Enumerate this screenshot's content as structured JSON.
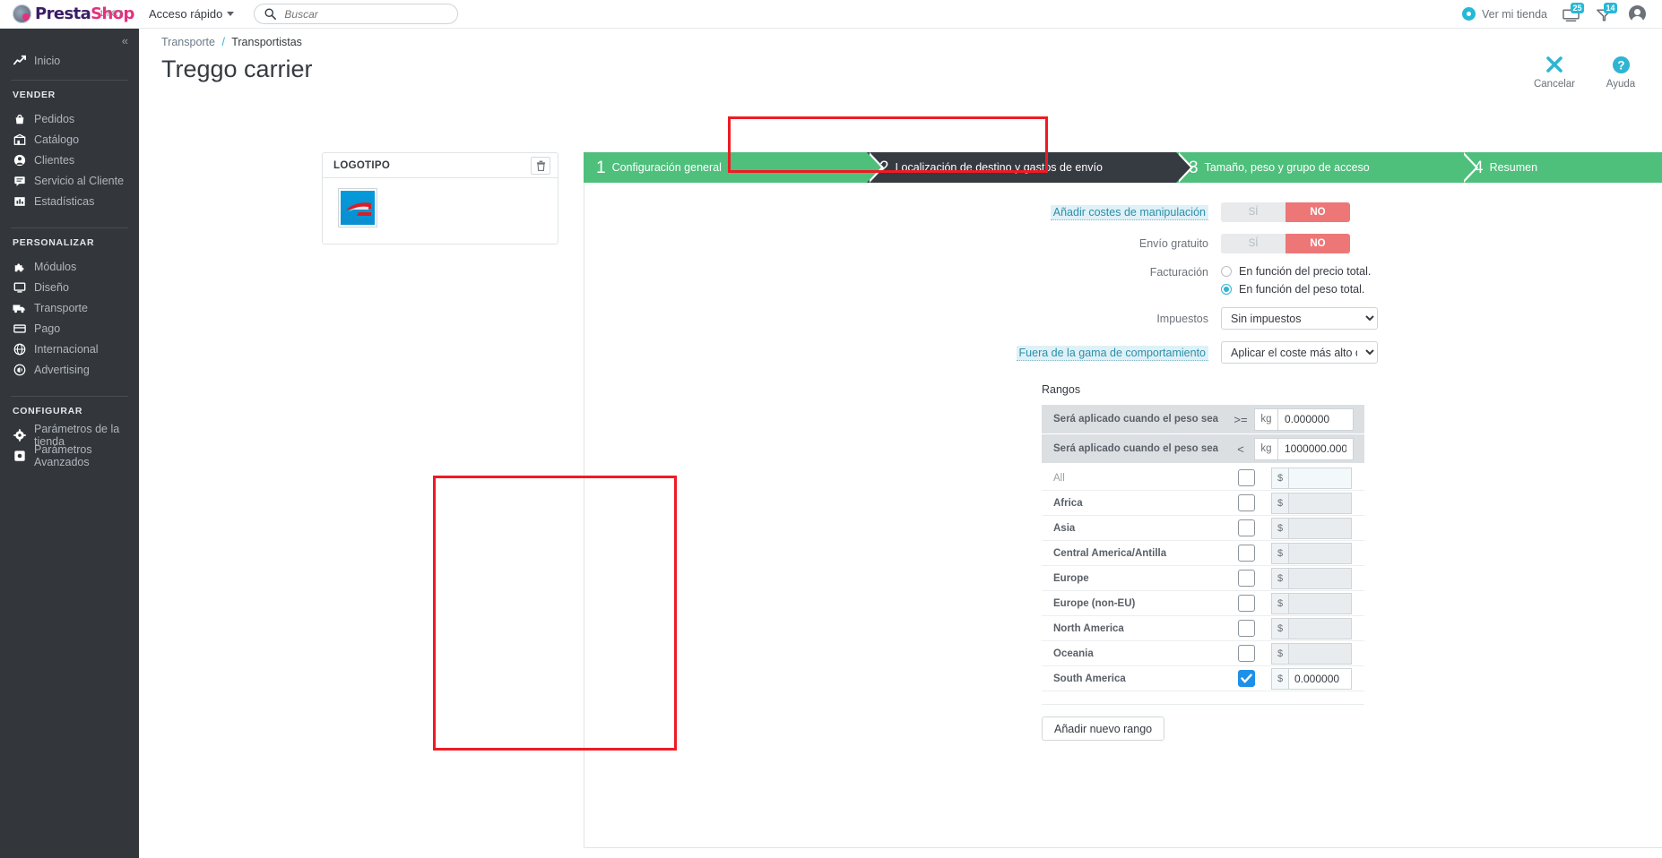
{
  "header": {
    "brand_presta": "Presta",
    "brand_shop": "Shop",
    "version": "1.7.8.7",
    "quick_access": "Acceso rápido",
    "search_placeholder": "Buscar",
    "view_shop": "Ver mi tienda",
    "badge_orders": "25",
    "badge_customers": "14"
  },
  "sidebar": {
    "collapse": "«",
    "home": {
      "label": "Inicio",
      "icon": "trend-up-icon"
    },
    "sections": [
      {
        "title": "VENDER",
        "items": [
          {
            "label": "Pedidos",
            "icon": "basket-icon"
          },
          {
            "label": "Catálogo",
            "icon": "catalog-icon"
          },
          {
            "label": "Clientes",
            "icon": "user-icon"
          },
          {
            "label": "Servicio al Cliente",
            "icon": "chat-icon"
          },
          {
            "label": "Estadísticas",
            "icon": "bar-chart-icon"
          }
        ]
      },
      {
        "title": "PERSONALIZAR",
        "items": [
          {
            "label": "Módulos",
            "icon": "puzzle-icon"
          },
          {
            "label": "Diseño",
            "icon": "monitor-icon"
          },
          {
            "label": "Transporte",
            "icon": "truck-icon"
          },
          {
            "label": "Pago",
            "icon": "credit-card-icon"
          },
          {
            "label": "Internacional",
            "icon": "globe-icon"
          },
          {
            "label": "Advertising",
            "icon": "megaphone-icon"
          }
        ]
      },
      {
        "title": "CONFIGURAR",
        "items": [
          {
            "label": "Parámetros de la tienda",
            "icon": "gear-icon"
          },
          {
            "label": "Parámetros Avanzados",
            "icon": "sliders-icon"
          }
        ]
      }
    ]
  },
  "page": {
    "breadcrumb_parent": "Transporte",
    "breadcrumb_sep": "/",
    "breadcrumb_current": "Transportistas",
    "title": "Treggo carrier",
    "cancel": "Cancelar",
    "help": "Ayuda"
  },
  "logo_card": {
    "title": "LOGOTIPO",
    "delete_icon": "trash-icon"
  },
  "steps": [
    {
      "num": "1",
      "label": "Configuración general",
      "state": "done"
    },
    {
      "num": "2",
      "label": "Localización de destino y gastos de envío",
      "state": "active"
    },
    {
      "num": "3",
      "label": "Tamaño, peso y grupo de acceso",
      "state": "done"
    },
    {
      "num": "4",
      "label": "Resumen",
      "state": "done"
    }
  ],
  "form": {
    "handling_costs": {
      "label": "Añadir costes de manipulación",
      "yes": "SÍ",
      "no": "NO",
      "value": "NO"
    },
    "free_shipping": {
      "label": "Envío gratuito",
      "yes": "SÍ",
      "no": "NO",
      "value": "NO"
    },
    "billing": {
      "label": "Facturación",
      "options": [
        {
          "label": "En función del precio total.",
          "selected": false
        },
        {
          "label": "En función del peso total.",
          "selected": true
        }
      ]
    },
    "taxes": {
      "label": "Impuestos",
      "value": "Sin impuestos",
      "options": [
        "Sin impuestos"
      ]
    },
    "out_of_range": {
      "label": "Fuera de la gama de comportamiento",
      "value": "Aplicar el coste más alto de la",
      "options": [
        "Aplicar el coste más alto de la"
      ]
    }
  },
  "ranges": {
    "title": "Rangos",
    "rows": [
      {
        "label": "Será aplicado cuando el peso sea",
        "op": ">=",
        "unit": "kg",
        "value": "0.000000"
      },
      {
        "label": "Será aplicado cuando el peso sea",
        "op": "<",
        "unit": "kg",
        "value": "1000000.000"
      }
    ]
  },
  "zones": {
    "currency": "$",
    "rows": [
      {
        "name": "All",
        "checked": false,
        "value": "",
        "muted": true
      },
      {
        "name": "Africa",
        "checked": false,
        "value": "",
        "muted": false
      },
      {
        "name": "Asia",
        "checked": false,
        "value": "",
        "muted": false
      },
      {
        "name": "Central America/Antilla",
        "checked": false,
        "value": "",
        "muted": false
      },
      {
        "name": "Europe",
        "checked": false,
        "value": "",
        "muted": false
      },
      {
        "name": "Europe (non-EU)",
        "checked": false,
        "value": "",
        "muted": false
      },
      {
        "name": "North America",
        "checked": false,
        "value": "",
        "muted": false
      },
      {
        "name": "Oceania",
        "checked": false,
        "value": "",
        "muted": false
      },
      {
        "name": "South America",
        "checked": true,
        "value": "0.000000",
        "muted": false
      }
    ]
  },
  "add_range_button": "Añadir nuevo rango",
  "colors": {
    "accent": "#2fb5d2",
    "step_done": "#4fbf7c",
    "step_active": "#363a41",
    "toggle_no": "#ed7777",
    "checkbox_on": "#1e90e8",
    "annotation": "#ee1b24",
    "brand_pink": "#e5307c",
    "brand_purple": "#3b1d66"
  }
}
